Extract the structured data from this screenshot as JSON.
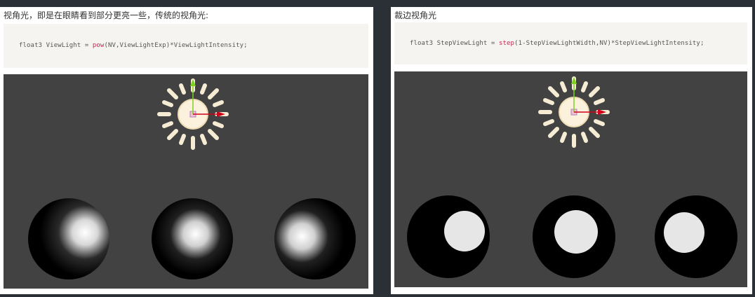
{
  "panels": [
    {
      "caption": "视角光，即是在眼睛看到部分更亮一些，传统的视角光:",
      "code": {
        "type": "float3",
        "var": "ViewLight",
        "op": " = ",
        "func": "pow",
        "args": "(NV,ViewLightExp)",
        "rest": "*ViewLightIntensity;"
      },
      "shading": "soft-highlight",
      "spheres": 3
    },
    {
      "caption": "裁边视角光",
      "code": {
        "type": "float3",
        "var": "StepViewLight",
        "op": " = ",
        "func": "step",
        "args": "(1-StepViewLightWidth,NV)",
        "rest": "*StepViewLightIntensity;"
      },
      "shading": "hard-disc",
      "spheres": 3
    }
  ],
  "icons": {
    "gizmo": "sun-light-icon",
    "y_axis": "y-axis-arrow-icon",
    "x_axis": "x-axis-arrow-icon"
  },
  "colors": {
    "viewport_bg": "#424242",
    "sun": "#f6ecd4",
    "axis_y": "#7ed321",
    "axis_x": "#d0021b",
    "code_func": "#c7254e"
  }
}
